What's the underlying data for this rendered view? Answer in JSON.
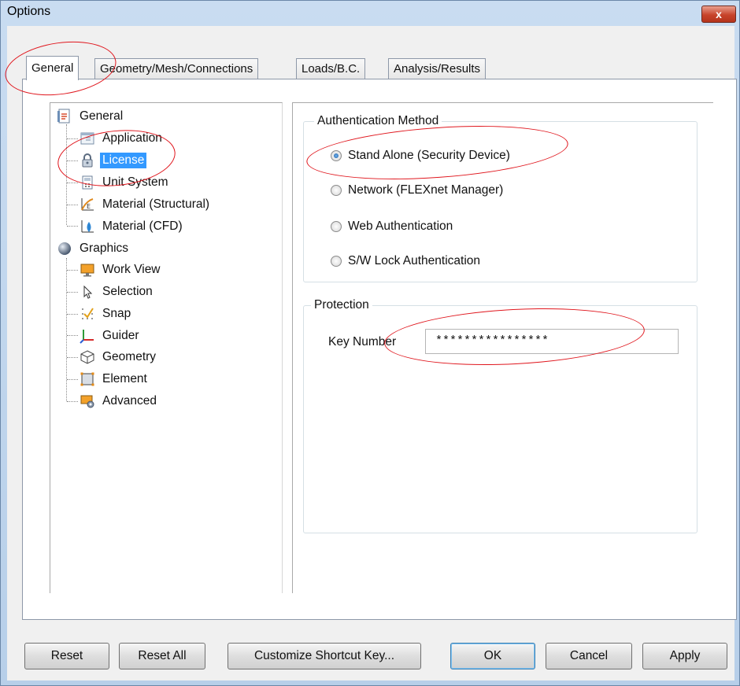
{
  "window": {
    "title": "Options",
    "close_label": "x"
  },
  "tabs": [
    {
      "label": "General",
      "active": true
    },
    {
      "label": "Geometry/Mesh/Connections",
      "active": false
    },
    {
      "label": "Loads/B.C.",
      "active": false
    },
    {
      "label": "Analysis/Results",
      "active": false
    }
  ],
  "tree": {
    "general": {
      "label": "General",
      "icon": "document-icon",
      "children": [
        {
          "label": "Application",
          "icon": "application-icon"
        },
        {
          "label": "License",
          "icon": "lock-icon",
          "selected": true
        },
        {
          "label": "Unit System",
          "icon": "unit-system-icon"
        },
        {
          "label": "Material (Structural)",
          "icon": "material-structural-icon"
        },
        {
          "label": "Material (CFD)",
          "icon": "material-cfd-icon"
        }
      ]
    },
    "graphics": {
      "label": "Graphics",
      "icon": "sphere-icon",
      "children": [
        {
          "label": "Work View",
          "icon": "monitor-icon"
        },
        {
          "label": "Selection",
          "icon": "cursor-icon"
        },
        {
          "label": "Snap",
          "icon": "snap-icon"
        },
        {
          "label": "Guider",
          "icon": "axes-icon"
        },
        {
          "label": "Geometry",
          "icon": "cube-icon"
        },
        {
          "label": "Element",
          "icon": "element-icon"
        },
        {
          "label": "Advanced",
          "icon": "advanced-icon"
        }
      ]
    }
  },
  "authentication": {
    "group_title": "Authentication Method",
    "options": [
      {
        "label": "Stand Alone (Security Device)",
        "checked": true
      },
      {
        "label": "Network (FLEXnet Manager)",
        "checked": false
      },
      {
        "label": "Web Authentication",
        "checked": false
      },
      {
        "label": "S/W Lock Authentication",
        "checked": false
      }
    ]
  },
  "protection": {
    "group_title": "Protection",
    "key_label": "Key Number",
    "key_value": "****************"
  },
  "buttons": {
    "reset": "Reset",
    "reset_all": "Reset All",
    "customize": "Customize Shortcut Key...",
    "ok": "OK",
    "cancel": "Cancel",
    "apply": "Apply"
  },
  "colors": {
    "selection": "#3399ff",
    "annotation": "#e0161d",
    "titlebar": "#c9dcf1"
  }
}
